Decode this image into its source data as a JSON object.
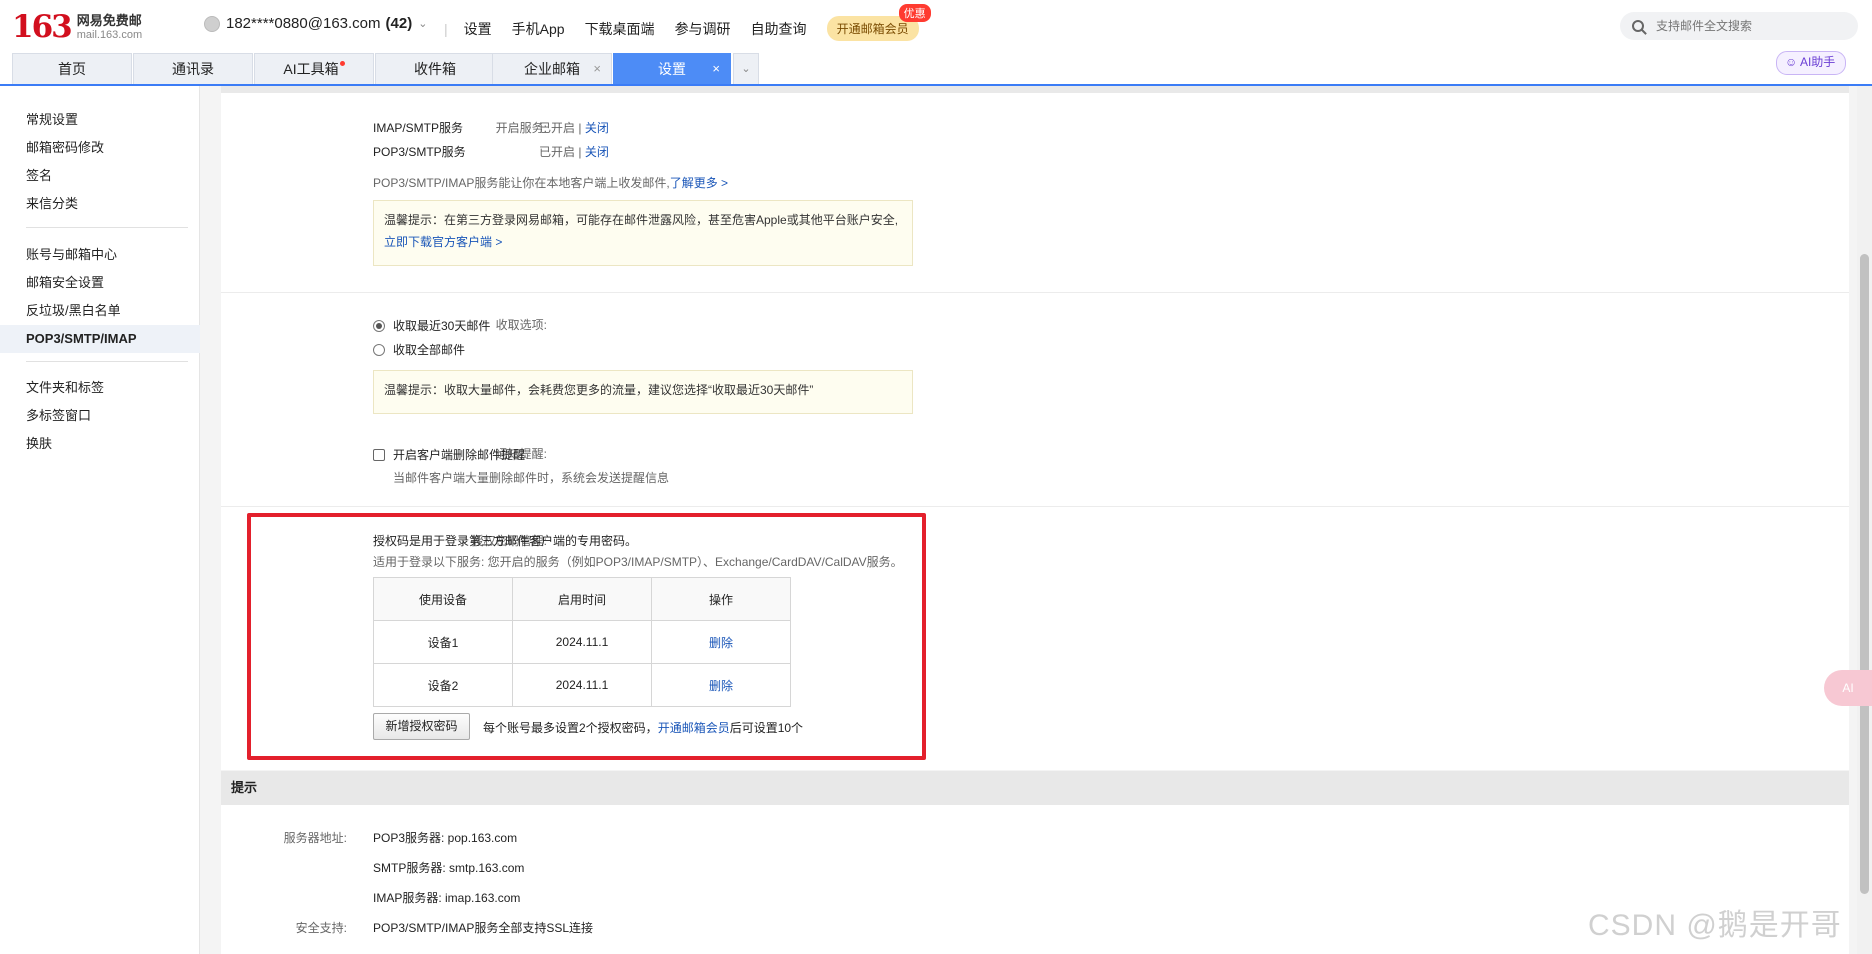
{
  "header": {
    "logo_num": "163",
    "logo_cn": "网易免费邮",
    "logo_en": "mail.163.com",
    "account": "182****0880@163.com",
    "account_count": "(42)",
    "nav": [
      "设置",
      "手机App",
      "下载桌面端",
      "参与调研",
      "自助查询"
    ],
    "vip_label": "开通邮箱会员",
    "vip_badge": "优惠",
    "search_placeholder": "支持邮件全文搜索"
  },
  "tabs": [
    {
      "label": "首页"
    },
    {
      "label": "通讯录"
    },
    {
      "label": "AI工具箱"
    },
    {
      "label": "收件箱"
    },
    {
      "label": "企业邮箱"
    },
    {
      "label": "设置"
    }
  ],
  "ai_helper": "AI助手",
  "sidebar": {
    "group1": [
      "常规设置",
      "邮箱密码修改",
      "签名",
      "来信分类"
    ],
    "group2": [
      "账号与邮箱中心",
      "邮箱安全设置",
      "反垃圾/黑白名单",
      "POP3/SMTP/IMAP"
    ],
    "group3": [
      "文件夹和标签",
      "多标签窗口",
      "换肤"
    ]
  },
  "service": {
    "label": "开启服务:",
    "imap_name": "IMAP/SMTP服务",
    "imap_status": "已开启",
    "pop3_name": "POP3/SMTP服务",
    "pop3_status": "已开启",
    "close_link": "关闭",
    "desc": "POP3/SMTP/IMAP服务能让你在本地客户端上收发邮件,",
    "learn_more": "了解更多 >",
    "tip_text": "温馨提示：在第三方登录网易邮箱，可能存在邮件泄露风险，甚至危害Apple或其他平台账户安全,",
    "tip_link": "立即下载官方客户端 >"
  },
  "receive": {
    "label": "收取选项:",
    "option1": "收取最近30天邮件",
    "option2": "收取全部邮件",
    "tip": "温馨提示：收取大量邮件，会耗费您更多的流量，建议您选择“收取最近30天邮件”"
  },
  "notify": {
    "label": "通知提醒:",
    "checkbox": "开启客户端删除邮件提醒",
    "desc": "当邮件客户端大量删除邮件时，系统会发送提醒信息"
  },
  "auth": {
    "label": "授权密码管理:",
    "desc1": "授权码是用于登录第三方邮件客户端的专用密码。",
    "desc2": "适用于登录以下服务: 您开启的服务（例如POP3/IMAP/SMTP）、Exchange/CardDAV/CalDAV服务。",
    "columns": [
      "使用设备",
      "启用时间",
      "操作"
    ],
    "rows": [
      {
        "device": "设备1",
        "time": "2024.11.1",
        "action": "删除"
      },
      {
        "device": "设备2",
        "time": "2024.11.1",
        "action": "删除"
      }
    ],
    "add_button": "新增授权密码",
    "note_before": "每个账号最多设置2个授权密码，",
    "note_link": "开通邮箱会员",
    "note_after": "后可设置10个"
  },
  "tips_section": {
    "title": "提示",
    "server_label": "服务器地址:",
    "pop3": "POP3服务器: pop.163.com",
    "smtp": "SMTP服务器: smtp.163.com",
    "imap": "IMAP服务器: imap.163.com",
    "security_label": "安全支持:",
    "security": "POP3/SMTP/IMAP服务全部支持SSL连接"
  },
  "watermark": "CSDN @鹅是开哥",
  "float_label": "AI",
  "colors": {
    "accent": "#4d8cf6",
    "link": "#1a56b8",
    "highlight": "#e3202c",
    "brand": "#d20f1e"
  }
}
